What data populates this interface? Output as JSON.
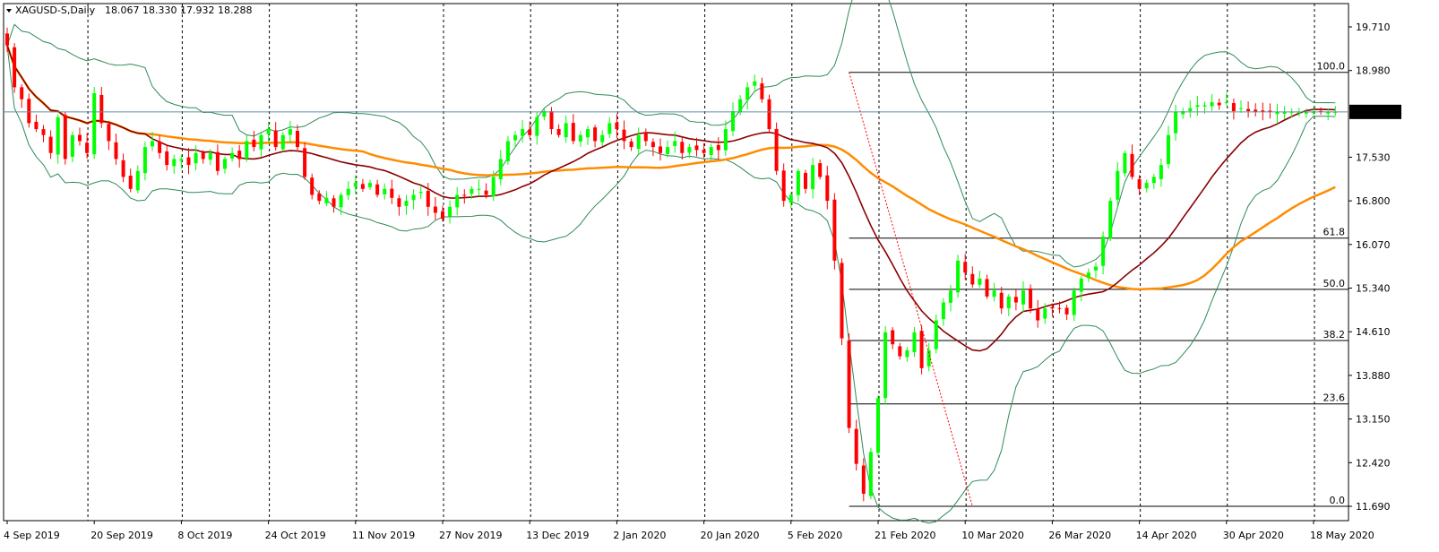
{
  "header": {
    "symbol": "XAGUSD-S,Daily",
    "ohlc": "18.067 18.330 17.932 18.288"
  },
  "colors": {
    "bull": "#00ff00",
    "bear": "#ff0000",
    "ma_fast": "#8b0000",
    "ma_slow": "#ff8c00",
    "bollinger": "#2e8b57",
    "fibo": "#000000",
    "trend": "#ff0000",
    "grid": "#000000",
    "price_label_bg": "#000000",
    "price_label_fg": "#ffffff",
    "bid_line": "#5f8fa0"
  },
  "chart_data": {
    "type": "candlestick",
    "title": "XAGUSD-S,Daily",
    "ylim": [
      11.45,
      20.1
    ],
    "y_ticks": [
      "19.710",
      "18.980",
      "17.530",
      "16.800",
      "16.070",
      "15.340",
      "14.610",
      "13.880",
      "13.150",
      "12.420",
      "11.690"
    ],
    "current_price": "18.288",
    "date_labels": [
      {
        "label": "4 Sep 2019",
        "x": 0
      },
      {
        "label": "20 Sep 2019",
        "x": 12
      },
      {
        "label": "8 Oct 2019",
        "x": 24
      },
      {
        "label": "24 Oct 2019",
        "x": 36
      },
      {
        "label": "11 Nov 2019",
        "x": 48
      },
      {
        "label": "27 Nov 2019",
        "x": 60
      },
      {
        "label": "13 Dec 2019",
        "x": 72
      },
      {
        "label": "2 Jan 2020",
        "x": 84
      },
      {
        "label": "20 Jan 2020",
        "x": 96
      },
      {
        "label": "5 Feb 2020",
        "x": 108
      },
      {
        "label": "21 Feb 2020",
        "x": 120
      },
      {
        "label": "10 Mar 2020",
        "x": 132
      },
      {
        "label": "26 Mar 2020",
        "x": 144
      },
      {
        "label": "14 Apr 2020",
        "x": 156
      },
      {
        "label": "30 Apr 2020",
        "x": 168
      },
      {
        "label": "18 May 2020",
        "x": 180
      }
    ],
    "vgrid_x": [
      11,
      24,
      36,
      48,
      60,
      72,
      84,
      96,
      108,
      120,
      132,
      144,
      156,
      168,
      180
    ],
    "fibonacci": {
      "x_start": 116,
      "price_100": 18.95,
      "price_0": 11.69,
      "levels": [
        {
          "label": "100.0",
          "ratio": 1.0
        },
        {
          "label": "61.8",
          "ratio": 0.618
        },
        {
          "label": "50.0",
          "ratio": 0.5
        },
        {
          "label": "38.2",
          "ratio": 0.382
        },
        {
          "label": "23.6",
          "ratio": 0.236
        },
        {
          "label": "0.0",
          "ratio": 0.0
        }
      ]
    },
    "trendline": {
      "x1": 116,
      "y1": 18.95,
      "x2": 133,
      "y2": 11.69
    },
    "closes": [
      19.4,
      18.7,
      18.5,
      18.1,
      18.0,
      17.9,
      17.6,
      18.2,
      17.5,
      17.9,
      17.8,
      17.6,
      18.6,
      18.1,
      17.8,
      17.5,
      17.2,
      17.0,
      17.3,
      17.7,
      17.8,
      17.6,
      17.4,
      17.5,
      17.5,
      17.4,
      17.6,
      17.5,
      17.6,
      17.3,
      17.5,
      17.6,
      17.5,
      17.8,
      17.7,
      17.9,
      18.0,
      17.7,
      17.9,
      18.0,
      17.7,
      17.2,
      16.9,
      16.8,
      16.85,
      16.7,
      16.9,
      17.0,
      17.1,
      17.0,
      17.1,
      16.9,
      17.0,
      16.85,
      16.7,
      16.8,
      16.9,
      16.95,
      16.7,
      16.6,
      16.5,
      16.7,
      16.9,
      16.9,
      17.0,
      17.0,
      16.9,
      17.2,
      17.5,
      17.8,
      17.9,
      18.0,
      17.9,
      18.2,
      18.3,
      18.0,
      17.9,
      18.1,
      17.8,
      17.9,
      18.0,
      17.8,
      17.9,
      18.1,
      18.0,
      17.8,
      17.7,
      17.9,
      17.8,
      17.7,
      17.6,
      17.7,
      17.8,
      17.6,
      17.7,
      17.65,
      17.6,
      17.7,
      17.65,
      18.0,
      18.3,
      18.5,
      18.7,
      18.8,
      18.5,
      18.0,
      17.3,
      16.8,
      16.9,
      17.3,
      17.0,
      17.4,
      17.2,
      16.8,
      15.8,
      14.5,
      13.0,
      12.4,
      11.9,
      12.6,
      13.5,
      14.6,
      14.4,
      14.2,
      14.3,
      14.6,
      14.0,
      14.3,
      14.8,
      15.1,
      15.3,
      15.8,
      15.6,
      15.4,
      15.5,
      15.2,
      15.3,
      15.0,
      15.2,
      15.1,
      15.3,
      15.0,
      14.8,
      15.0,
      15.0,
      15.0,
      14.9,
      15.3,
      15.5,
      15.6,
      15.7,
      16.2,
      16.8,
      17.3,
      17.6,
      17.2,
      17.0,
      17.1,
      17.2,
      17.4,
      17.9,
      18.288,
      18.3,
      18.35,
      18.4,
      18.4,
      18.45,
      18.4,
      18.45,
      18.3,
      18.35,
      18.3,
      18.288,
      18.288,
      18.288,
      18.288,
      18.288,
      18.288,
      18.288,
      18.288,
      18.288,
      18.288,
      18.288,
      18.288,
      18.288,
      18.288,
      18.288,
      18.288,
      18.288
    ]
  }
}
